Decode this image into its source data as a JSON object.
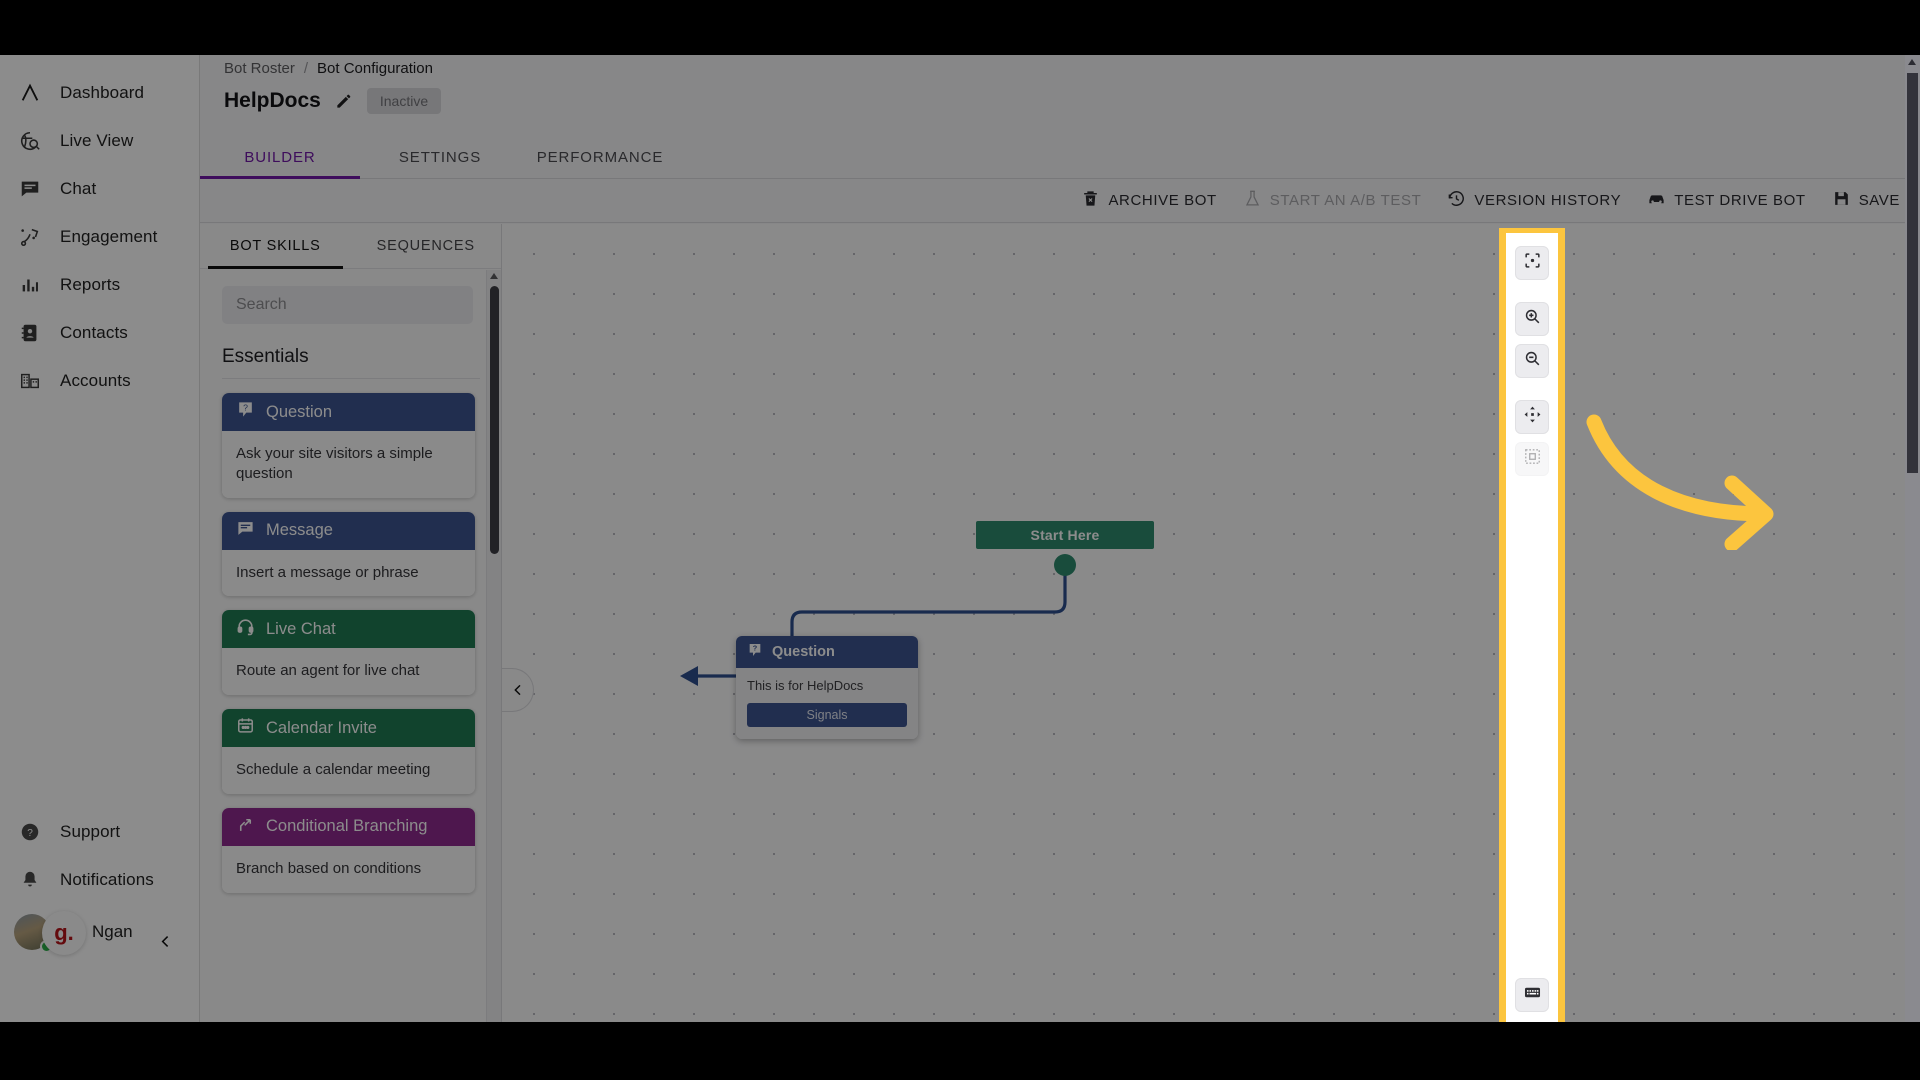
{
  "colors": {
    "accent_purple": "#7218a8",
    "highlight_yellow": "#fcc53e",
    "skill_blue": "#3c5490",
    "skill_green": "#1f7a53",
    "skill_purple": "#8e2a8e",
    "start_node_green": "#2e8b6e"
  },
  "sidebar": {
    "top_items": [
      {
        "label": "Dashboard",
        "icon": "logo-a-icon"
      },
      {
        "label": "Live View",
        "icon": "live-view-icon"
      },
      {
        "label": "Chat",
        "icon": "chat-icon"
      },
      {
        "label": "Engagement",
        "icon": "engagement-icon"
      },
      {
        "label": "Reports",
        "icon": "reports-icon"
      },
      {
        "label": "Contacts",
        "icon": "contacts-icon"
      },
      {
        "label": "Accounts",
        "icon": "accounts-icon"
      }
    ],
    "bottom_items": [
      {
        "label": "Support",
        "icon": "help-circle-icon"
      },
      {
        "label": "Notifications",
        "icon": "bell-icon"
      }
    ],
    "user": {
      "name": "Ngan",
      "badge_text": "g."
    },
    "collapse_icon": "chevron-left-icon"
  },
  "breadcrumb": {
    "parent": "Bot Roster",
    "separator": "/",
    "current": "Bot Configuration"
  },
  "header": {
    "bot_name": "HelpDocs",
    "edit_icon": "pencil-icon",
    "status": "Inactive"
  },
  "tabs": [
    {
      "label": "BUILDER",
      "active": true
    },
    {
      "label": "SETTINGS",
      "active": false
    },
    {
      "label": "PERFORMANCE",
      "active": false
    }
  ],
  "toolbar": [
    {
      "label": "ARCHIVE BOT",
      "icon": "trash-icon",
      "disabled": false
    },
    {
      "label": "START AN A/B TEST",
      "icon": "flask-icon",
      "disabled": true
    },
    {
      "label": "VERSION HISTORY",
      "icon": "history-clock-icon",
      "disabled": false
    },
    {
      "label": "TEST DRIVE BOT",
      "icon": "car-icon",
      "disabled": false
    },
    {
      "label": "SAVE",
      "icon": "floppy-disk-icon",
      "disabled": false
    }
  ],
  "skills_panel": {
    "tabs": [
      {
        "label": "BOT SKILLS",
        "active": true
      },
      {
        "label": "SEQUENCES",
        "active": false
      }
    ],
    "search_placeholder": "Search",
    "search_value": "",
    "section_title": "Essentials",
    "cards": [
      {
        "title": "Question",
        "description": "Ask your site visitors a simple question",
        "color": "#3c5490",
        "icon": "question-badge-icon"
      },
      {
        "title": "Message",
        "description": "Insert a message or phrase",
        "color": "#3c5490",
        "icon": "message-icon"
      },
      {
        "title": "Live Chat",
        "description": "Route an agent for live chat",
        "color": "#1f7a53",
        "icon": "headset-icon"
      },
      {
        "title": "Calendar Invite",
        "description": "Schedule a calendar meeting",
        "color": "#1f7a53",
        "icon": "calendar-icon"
      },
      {
        "title": "Conditional Branching",
        "description": "Branch based on conditions",
        "color": "#8e2a8e",
        "icon": "branch-icon"
      }
    ],
    "collapse_icon": "chevron-left-icon"
  },
  "canvas": {
    "start_node": {
      "label": "Start Here"
    },
    "question_node": {
      "title": "Question",
      "text": "This is for HelpDocs",
      "button_label": "Signals",
      "icon": "question-badge-icon"
    }
  },
  "canvas_toolbar": {
    "buttons": [
      {
        "name": "fit-to-screen",
        "icon": "focus-target-icon",
        "disabled": false
      },
      {
        "name": "zoom-in",
        "icon": "zoom-in-icon",
        "disabled": false
      },
      {
        "name": "zoom-out",
        "icon": "zoom-out-icon",
        "disabled": false
      },
      {
        "name": "pan-mode",
        "icon": "move-arrows-icon",
        "disabled": false
      },
      {
        "name": "select-region",
        "icon": "dashed-select-icon",
        "disabled": true
      }
    ],
    "bottom_buttons": [
      {
        "name": "keyboard-shortcuts",
        "icon": "keyboard-icon",
        "disabled": false
      },
      {
        "name": "fullscreen",
        "icon": "expand-corners-icon",
        "disabled": false
      }
    ]
  },
  "annotation": {
    "type": "curved-arrow",
    "color": "#fcc53e",
    "points_to": "canvas-toolbar"
  }
}
